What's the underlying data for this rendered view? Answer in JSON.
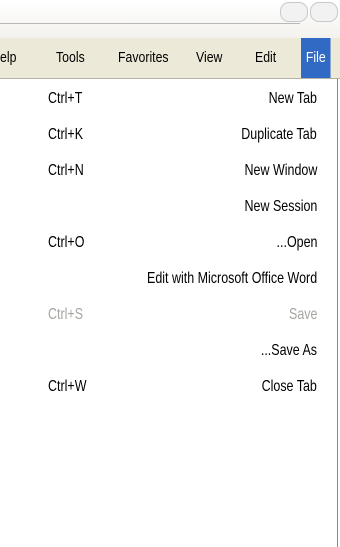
{
  "menubar": {
    "items": [
      "elp",
      "Tools",
      "Favorites",
      "View",
      "Edit",
      "File"
    ],
    "active": "File"
  },
  "file_menu": {
    "items": [
      {
        "label": "New Tab",
        "shortcut": "Ctrl+T",
        "enabled": true
      },
      {
        "label": "Duplicate Tab",
        "shortcut": "Ctrl+K",
        "enabled": true
      },
      {
        "label": "New Window",
        "shortcut": "Ctrl+N",
        "enabled": true
      },
      {
        "label": "New Session",
        "shortcut": "",
        "enabled": true
      },
      {
        "label": "...Open",
        "shortcut": "Ctrl+O",
        "enabled": true
      },
      {
        "label": "Edit with Microsoft Office Word",
        "shortcut": "",
        "enabled": true
      },
      {
        "label": "Save",
        "shortcut": "Ctrl+S",
        "enabled": false
      },
      {
        "label": "...Save As",
        "shortcut": "",
        "enabled": true
      },
      {
        "label": "Close Tab",
        "shortcut": "Ctrl+W",
        "enabled": true
      }
    ]
  },
  "colors": {
    "menubar_bg": "#ece9d8",
    "highlight": "#316ac5",
    "disabled_text": "#a6a5a0"
  }
}
